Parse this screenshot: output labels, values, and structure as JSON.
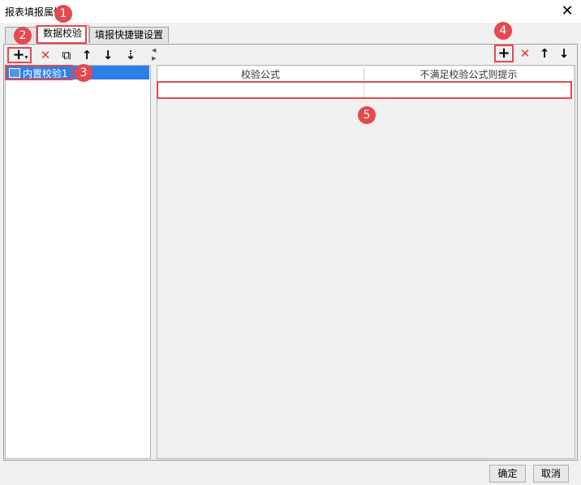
{
  "window": {
    "title": "报表填报属性",
    "close_glyph": "✕"
  },
  "tabs": [
    {
      "label": ""
    },
    {
      "label": "数据校验"
    },
    {
      "label": "填报快捷键设置"
    }
  ],
  "left_toolbar": {
    "add_glyph": "+",
    "delete_glyph": "✕",
    "copy_glyph": "⧉",
    "up_glyph": "↑",
    "down_glyph": "↓",
    "sort_glyph": "⇣"
  },
  "tree": {
    "items": [
      {
        "label": "内置校验1"
      }
    ]
  },
  "right_toolbar": {
    "add_glyph": "+",
    "delete_glyph": "✕",
    "up_glyph": "↑",
    "down_glyph": "↓"
  },
  "grid": {
    "columns": [
      "校验公式",
      "不满足校验公式则提示"
    ]
  },
  "footer": {
    "ok_label": "确定",
    "cancel_label": "取消"
  },
  "annotations": [
    "1",
    "2",
    "3",
    "4",
    "5"
  ],
  "colors": {
    "accent": "#2f7fe6",
    "highlight": "#e5484d"
  }
}
